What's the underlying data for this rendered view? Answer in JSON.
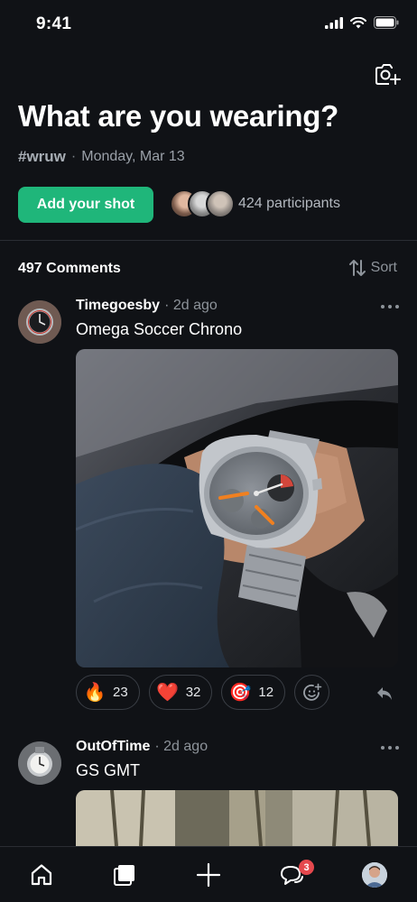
{
  "status_bar": {
    "time": "9:41"
  },
  "header": {
    "title": "What are you wearing?",
    "hashtag": "#wruw",
    "separator": "·",
    "date": "Monday, Mar 13",
    "add_shot_label": "Add your shot",
    "participants_label": "424 participants"
  },
  "comments_bar": {
    "count_label": "497 Comments",
    "sort_label": "Sort"
  },
  "posts": [
    {
      "author": "Timegoesby",
      "time": "· 2d ago",
      "text": "Omega Soccer Chrono",
      "reactions": [
        {
          "emoji": "🔥",
          "icon": "fire-icon",
          "count": "23"
        },
        {
          "emoji": "❤️",
          "icon": "heart-icon",
          "count": "32"
        },
        {
          "emoji": "🎯",
          "icon": "target-icon",
          "count": "12"
        }
      ]
    },
    {
      "author": "OutOfTime",
      "time": "· 2d ago",
      "text": "GS GMT"
    }
  ],
  "tab_bar": {
    "items": [
      "home-icon",
      "collection-icon",
      "plus-icon",
      "chat-icon",
      "profile-avatar"
    ],
    "chat_badge": "3"
  },
  "colors": {
    "background": "#101216",
    "accent": "#1fb67a",
    "badge": "#e5484d",
    "muted": "#8d939a"
  }
}
